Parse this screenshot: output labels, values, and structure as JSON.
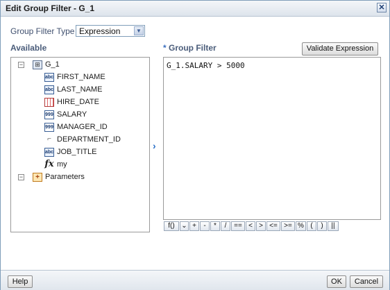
{
  "dialog": {
    "title": "Edit Group Filter - G_1",
    "close_glyph": "✕"
  },
  "group_filter_type": {
    "label": "Group Filter Type",
    "selected": "Expression"
  },
  "available": {
    "heading": "Available",
    "root": "G_1",
    "fields": [
      {
        "name": "FIRST_NAME",
        "icon": "abc",
        "type": "text"
      },
      {
        "name": "LAST_NAME",
        "icon": "abc",
        "type": "text"
      },
      {
        "name": "HIRE_DATE",
        "icon": "",
        "type": "date"
      },
      {
        "name": "SALARY",
        "icon": "999",
        "type": "number"
      },
      {
        "name": "MANAGER_ID",
        "icon": "999",
        "type": "number"
      },
      {
        "name": "DEPARTMENT_ID",
        "icon": "⌐",
        "type": "link"
      },
      {
        "name": "JOB_TITLE",
        "icon": "abc",
        "type": "text"
      },
      {
        "name": "my",
        "icon": "fx",
        "type": "function"
      }
    ],
    "parameters": "Parameters"
  },
  "group_filter": {
    "required_marker": "*",
    "heading": "Group Filter",
    "validate_button": "Validate Expression",
    "expression": "G_1.SALARY > 5000"
  },
  "operators": [
    "f()",
    "⌄",
    "+",
    "-",
    "*",
    "/",
    "==",
    "<",
    ">",
    "<=",
    ">=",
    "%",
    "(",
    ")",
    "||"
  ],
  "footer": {
    "help": "Help",
    "ok": "OK",
    "cancel": "Cancel"
  },
  "icons": {
    "collapse": "−",
    "move_right": "›",
    "group": "⊞",
    "parameters": "+"
  }
}
